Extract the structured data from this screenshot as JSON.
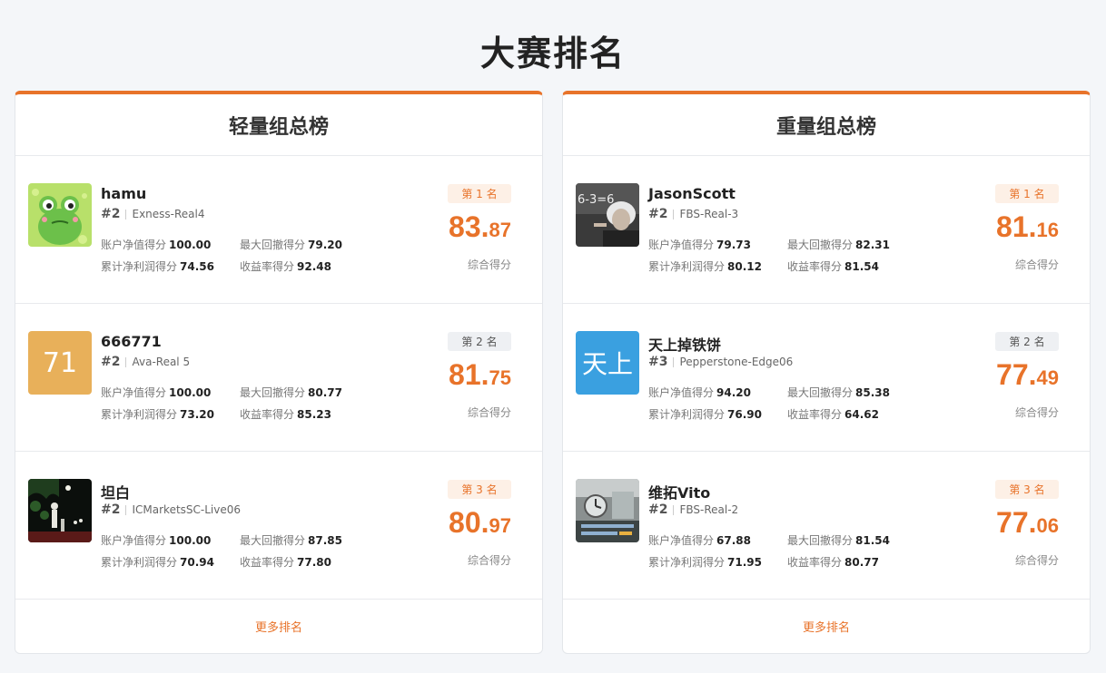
{
  "title": "大赛排名",
  "stat_labels": {
    "equity": "账户净值得分",
    "drawdown": "最大回撤得分",
    "profit": "累计净利润得分",
    "return": "收益率得分"
  },
  "score_label": "综合得分",
  "more_label": "更多排名",
  "colors": {
    "accent": "#e8732a"
  },
  "boards": [
    {
      "title": "轻量组总榜",
      "entries": [
        {
          "badge": "第 1 名",
          "name": "hamu",
          "rank": "#2",
          "account": "Exness-Real4",
          "equity": "100.00",
          "drawdown": "79.20",
          "profit": "74.56",
          "return": "92.48",
          "score_int": "83.",
          "score_dec": "87",
          "avatar": "frog-avatar-icon"
        },
        {
          "badge": "第 2 名",
          "name": "666771",
          "rank": "#2",
          "account": "Ava-Real 5",
          "equity": "100.00",
          "drawdown": "80.77",
          "profit": "73.20",
          "return": "85.23",
          "score_int": "81.",
          "score_dec": "75",
          "avatar_text": "71",
          "avatar_color": "#e8b05a"
        },
        {
          "badge": "第 3 名",
          "name": "坦白",
          "rank": "#2",
          "account": "ICMarketsSC-Live06",
          "equity": "100.00",
          "drawdown": "87.85",
          "profit": "70.94",
          "return": "77.80",
          "score_int": "80.",
          "score_dec": "97",
          "avatar": "night-scene-avatar-icon"
        }
      ]
    },
    {
      "title": "重量组总榜",
      "entries": [
        {
          "badge": "第 1 名",
          "name": "JasonScott",
          "rank": "#2",
          "account": "FBS-Real-3",
          "equity": "79.73",
          "drawdown": "82.31",
          "profit": "80.12",
          "return": "81.54",
          "score_int": "81.",
          "score_dec": "16",
          "avatar": "einstein-avatar-icon"
        },
        {
          "badge": "第 2 名",
          "name": "天上掉铁饼",
          "rank": "#3",
          "account": "Pepperstone-Edge06",
          "equity": "94.20",
          "drawdown": "85.38",
          "profit": "76.90",
          "return": "64.62",
          "score_int": "77.",
          "score_dec": "49",
          "avatar_text": "天上",
          "avatar_color": "#3aa0e0"
        },
        {
          "badge": "第 3 名",
          "name": "维拓Vito",
          "rank": "#2",
          "account": "FBS-Real-2",
          "equity": "67.88",
          "drawdown": "81.54",
          "profit": "71.95",
          "return": "80.77",
          "score_int": "77.",
          "score_dec": "06",
          "avatar": "clock-photo-avatar-icon"
        }
      ]
    }
  ]
}
